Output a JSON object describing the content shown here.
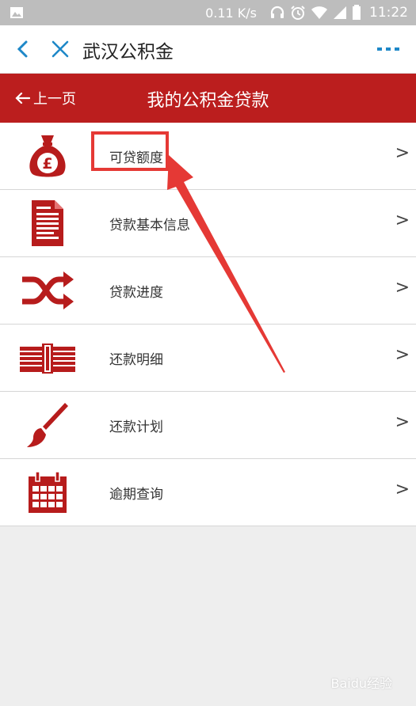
{
  "status_bar": {
    "speed": "0.11 K/s",
    "time": "11:22",
    "icons": [
      "image-icon",
      "headphones-icon",
      "alarm-icon",
      "wifi-icon",
      "signal-icon",
      "battery-icon"
    ]
  },
  "header": {
    "title": "武汉公积金",
    "icons": [
      "back-icon",
      "close-icon",
      "more-icon"
    ],
    "accent": "#1e88c8"
  },
  "subheader": {
    "prev_label": "上一页",
    "title": "我的公积金贷款",
    "color": "#bb1e1e"
  },
  "menu": {
    "items": [
      {
        "label": "可贷额度",
        "icon": "money-bag-icon",
        "chevron": ">"
      },
      {
        "label": "贷款基本信息",
        "icon": "document-icon",
        "chevron": ">"
      },
      {
        "label": "贷款进度",
        "icon": "shuffle-icon",
        "chevron": ">"
      },
      {
        "label": "还款明细",
        "icon": "banknotes-icon",
        "chevron": ">"
      },
      {
        "label": "还款计划",
        "icon": "brush-icon",
        "chevron": ">"
      },
      {
        "label": "逾期查询",
        "icon": "calendar-icon",
        "chevron": ">"
      }
    ],
    "icon_color": "#b71c1c"
  },
  "annotation": {
    "color": "#e53935"
  },
  "watermark": "Baidu经验"
}
